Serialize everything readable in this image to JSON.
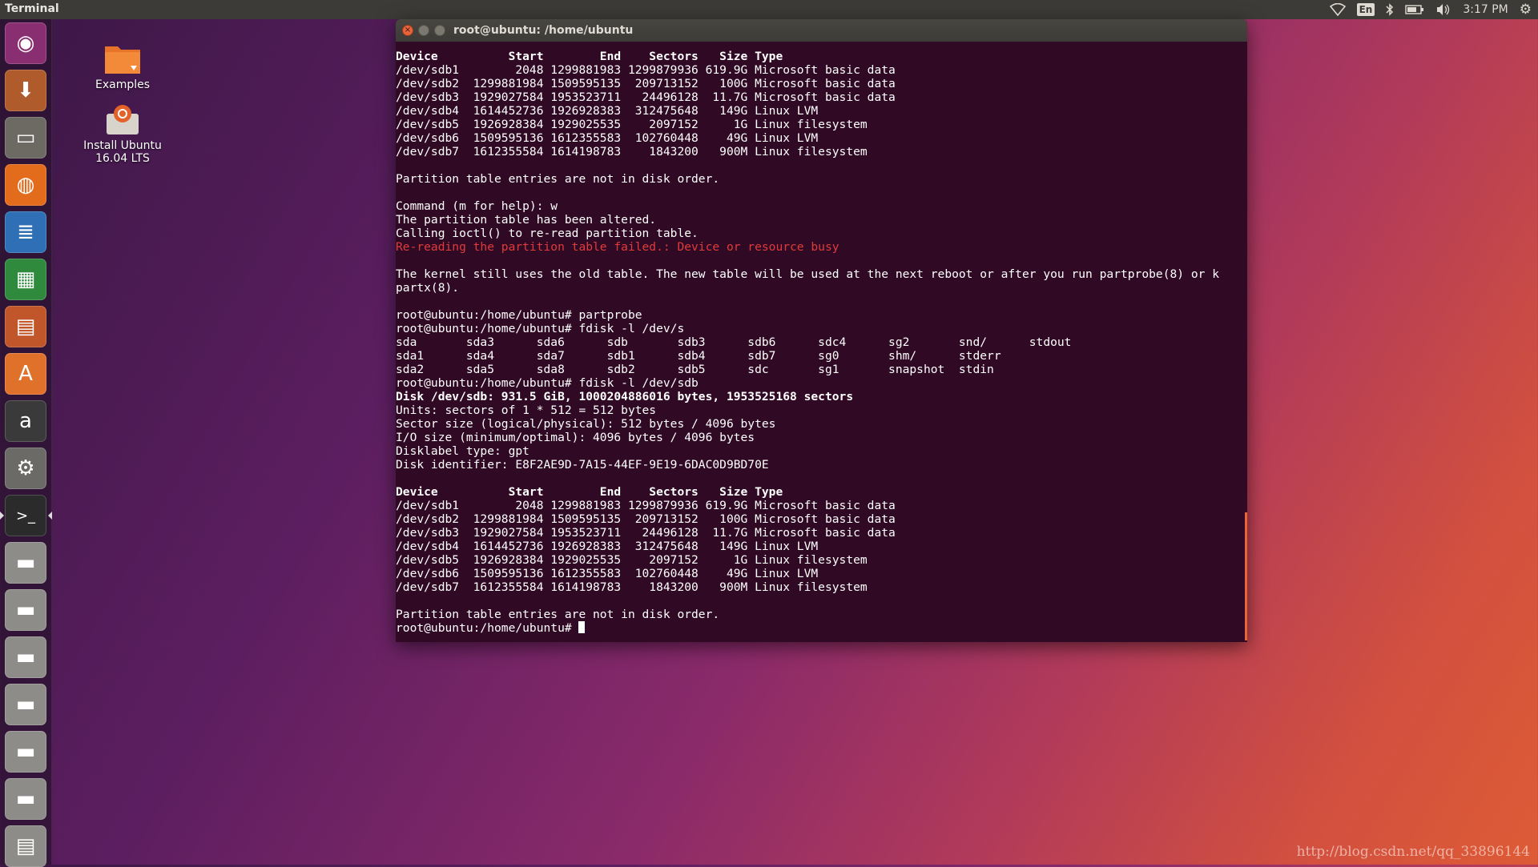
{
  "topbar": {
    "app_title": "Terminal",
    "keyboard_layout": "En",
    "clock": "3:17 PM"
  },
  "launcher": {
    "items": [
      {
        "name": "dash-home",
        "icon": "ubuntu-logo-icon",
        "glyph": "◉",
        "color": "#8a2e72"
      },
      {
        "name": "install-ubuntu",
        "icon": "install-ubuntu-icon",
        "glyph": "⬇",
        "color": "#b05b2b"
      },
      {
        "name": "files",
        "icon": "file-manager-icon",
        "glyph": "▭",
        "color": "#6c6a63"
      },
      {
        "name": "firefox",
        "icon": "firefox-icon",
        "glyph": "◍",
        "color": "#e26b1c"
      },
      {
        "name": "writer",
        "icon": "libreoffice-writer-icon",
        "glyph": "≣",
        "color": "#2f6fb5"
      },
      {
        "name": "calc",
        "icon": "libreoffice-calc-icon",
        "glyph": "▦",
        "color": "#2f8a3d"
      },
      {
        "name": "impress",
        "icon": "libreoffice-impress-icon",
        "glyph": "▤",
        "color": "#c0562a"
      },
      {
        "name": "software-center",
        "icon": "software-center-icon",
        "glyph": "A",
        "color": "#e0712b"
      },
      {
        "name": "amazon",
        "icon": "amazon-icon",
        "glyph": "a",
        "color": "#3a3a3a"
      },
      {
        "name": "system-settings",
        "icon": "settings-icon",
        "glyph": "⚙",
        "color": "#6b6a66"
      },
      {
        "name": "terminal",
        "icon": "terminal-icon",
        "glyph": ">_",
        "color": "#2b2b2b"
      },
      {
        "name": "drive-1",
        "icon": "drive-icon",
        "glyph": "▬",
        "color": "#8e8c88"
      },
      {
        "name": "drive-2",
        "icon": "drive-icon",
        "glyph": "▬",
        "color": "#8e8c88"
      },
      {
        "name": "drive-3",
        "icon": "drive-icon",
        "glyph": "▬",
        "color": "#8e8c88"
      },
      {
        "name": "drive-4",
        "icon": "drive-icon",
        "glyph": "▬",
        "color": "#8e8c88"
      },
      {
        "name": "drive-5",
        "icon": "drive-icon",
        "glyph": "▬",
        "color": "#8e8c88"
      },
      {
        "name": "drive-6",
        "icon": "drive-icon",
        "glyph": "▬",
        "color": "#8e8c88"
      },
      {
        "name": "trash",
        "icon": "trash-icon",
        "glyph": "▤",
        "color": "#8e8c88"
      }
    ]
  },
  "desktop": {
    "examples_label": "Examples",
    "install_label_1": "Install Ubuntu",
    "install_label_2": "16.04 LTS"
  },
  "terminal": {
    "window_title": "root@ubuntu: /home/ubuntu",
    "lines": [
      {
        "text": "Device          Start        End    Sectors   Size Type",
        "style": "bold"
      },
      {
        "text": "/dev/sdb1        2048 1299881983 1299879936 619.9G Microsoft basic data",
        "style": ""
      },
      {
        "text": "/dev/sdb2  1299881984 1509595135  209713152   100G Microsoft basic data",
        "style": ""
      },
      {
        "text": "/dev/sdb3  1929027584 1953523711   24496128  11.7G Microsoft basic data",
        "style": ""
      },
      {
        "text": "/dev/sdb4  1614452736 1926928383  312475648   149G Linux LVM",
        "style": ""
      },
      {
        "text": "/dev/sdb5  1926928384 1929025535    2097152     1G Linux filesystem",
        "style": ""
      },
      {
        "text": "/dev/sdb6  1509595136 1612355583  102760448    49G Linux LVM",
        "style": ""
      },
      {
        "text": "/dev/sdb7  1612355584 1614198783    1843200   900M Linux filesystem",
        "style": ""
      },
      {
        "text": "",
        "style": ""
      },
      {
        "text": "Partition table entries are not in disk order.",
        "style": ""
      },
      {
        "text": "",
        "style": ""
      },
      {
        "text": "Command (m for help): w",
        "style": ""
      },
      {
        "text": "The partition table has been altered.",
        "style": ""
      },
      {
        "text": "Calling ioctl() to re-read partition table.",
        "style": ""
      },
      {
        "text": "Re-reading the partition table failed.: Device or resource busy",
        "style": "error"
      },
      {
        "text": "",
        "style": ""
      },
      {
        "text": "The kernel still uses the old table. The new table will be used at the next reboot or after you run partprobe(8) or k",
        "style": ""
      },
      {
        "text": "partx(8).",
        "style": ""
      },
      {
        "text": "",
        "style": ""
      },
      {
        "text": "root@ubuntu:/home/ubuntu# partprobe",
        "style": ""
      },
      {
        "text": "root@ubuntu:/home/ubuntu# fdisk -l /dev/s",
        "style": ""
      },
      {
        "text": "sda       sda3      sda6      sdb       sdb3      sdb6      sdc4      sg2       snd/      stdout",
        "style": ""
      },
      {
        "text": "sda1      sda4      sda7      sdb1      sdb4      sdb7      sg0       shm/      stderr",
        "style": ""
      },
      {
        "text": "sda2      sda5      sda8      sdb2      sdb5      sdc       sg1       snapshot  stdin",
        "style": ""
      },
      {
        "text": "root@ubuntu:/home/ubuntu# fdisk -l /dev/sdb",
        "style": ""
      },
      {
        "text": "Disk /dev/sdb: 931.5 GiB, 1000204886016 bytes, 1953525168 sectors",
        "style": "bold"
      },
      {
        "text": "Units: sectors of 1 * 512 = 512 bytes",
        "style": ""
      },
      {
        "text": "Sector size (logical/physical): 512 bytes / 4096 bytes",
        "style": ""
      },
      {
        "text": "I/O size (minimum/optimal): 4096 bytes / 4096 bytes",
        "style": ""
      },
      {
        "text": "Disklabel type: gpt",
        "style": ""
      },
      {
        "text": "Disk identifier: E8F2AE9D-7A15-44EF-9E19-6DAC0D9BD70E",
        "style": ""
      },
      {
        "text": "",
        "style": ""
      },
      {
        "text": "Device          Start        End    Sectors   Size Type",
        "style": "bold"
      },
      {
        "text": "/dev/sdb1        2048 1299881983 1299879936 619.9G Microsoft basic data",
        "style": ""
      },
      {
        "text": "/dev/sdb2  1299881984 1509595135  209713152   100G Microsoft basic data",
        "style": ""
      },
      {
        "text": "/dev/sdb3  1929027584 1953523711   24496128  11.7G Microsoft basic data",
        "style": ""
      },
      {
        "text": "/dev/sdb4  1614452736 1926928383  312475648   149G Linux LVM",
        "style": ""
      },
      {
        "text": "/dev/sdb5  1926928384 1929025535    2097152     1G Linux filesystem",
        "style": ""
      },
      {
        "text": "/dev/sdb6  1509595136 1612355583  102760448    49G Linux LVM",
        "style": ""
      },
      {
        "text": "/dev/sdb7  1612355584 1614198783    1843200   900M Linux filesystem",
        "style": ""
      },
      {
        "text": "",
        "style": ""
      },
      {
        "text": "Partition table entries are not in disk order.",
        "style": ""
      }
    ],
    "prompt": "root@ubuntu:/home/ubuntu# "
  },
  "watermark": "http://blog.csdn.net/qq_33896144"
}
